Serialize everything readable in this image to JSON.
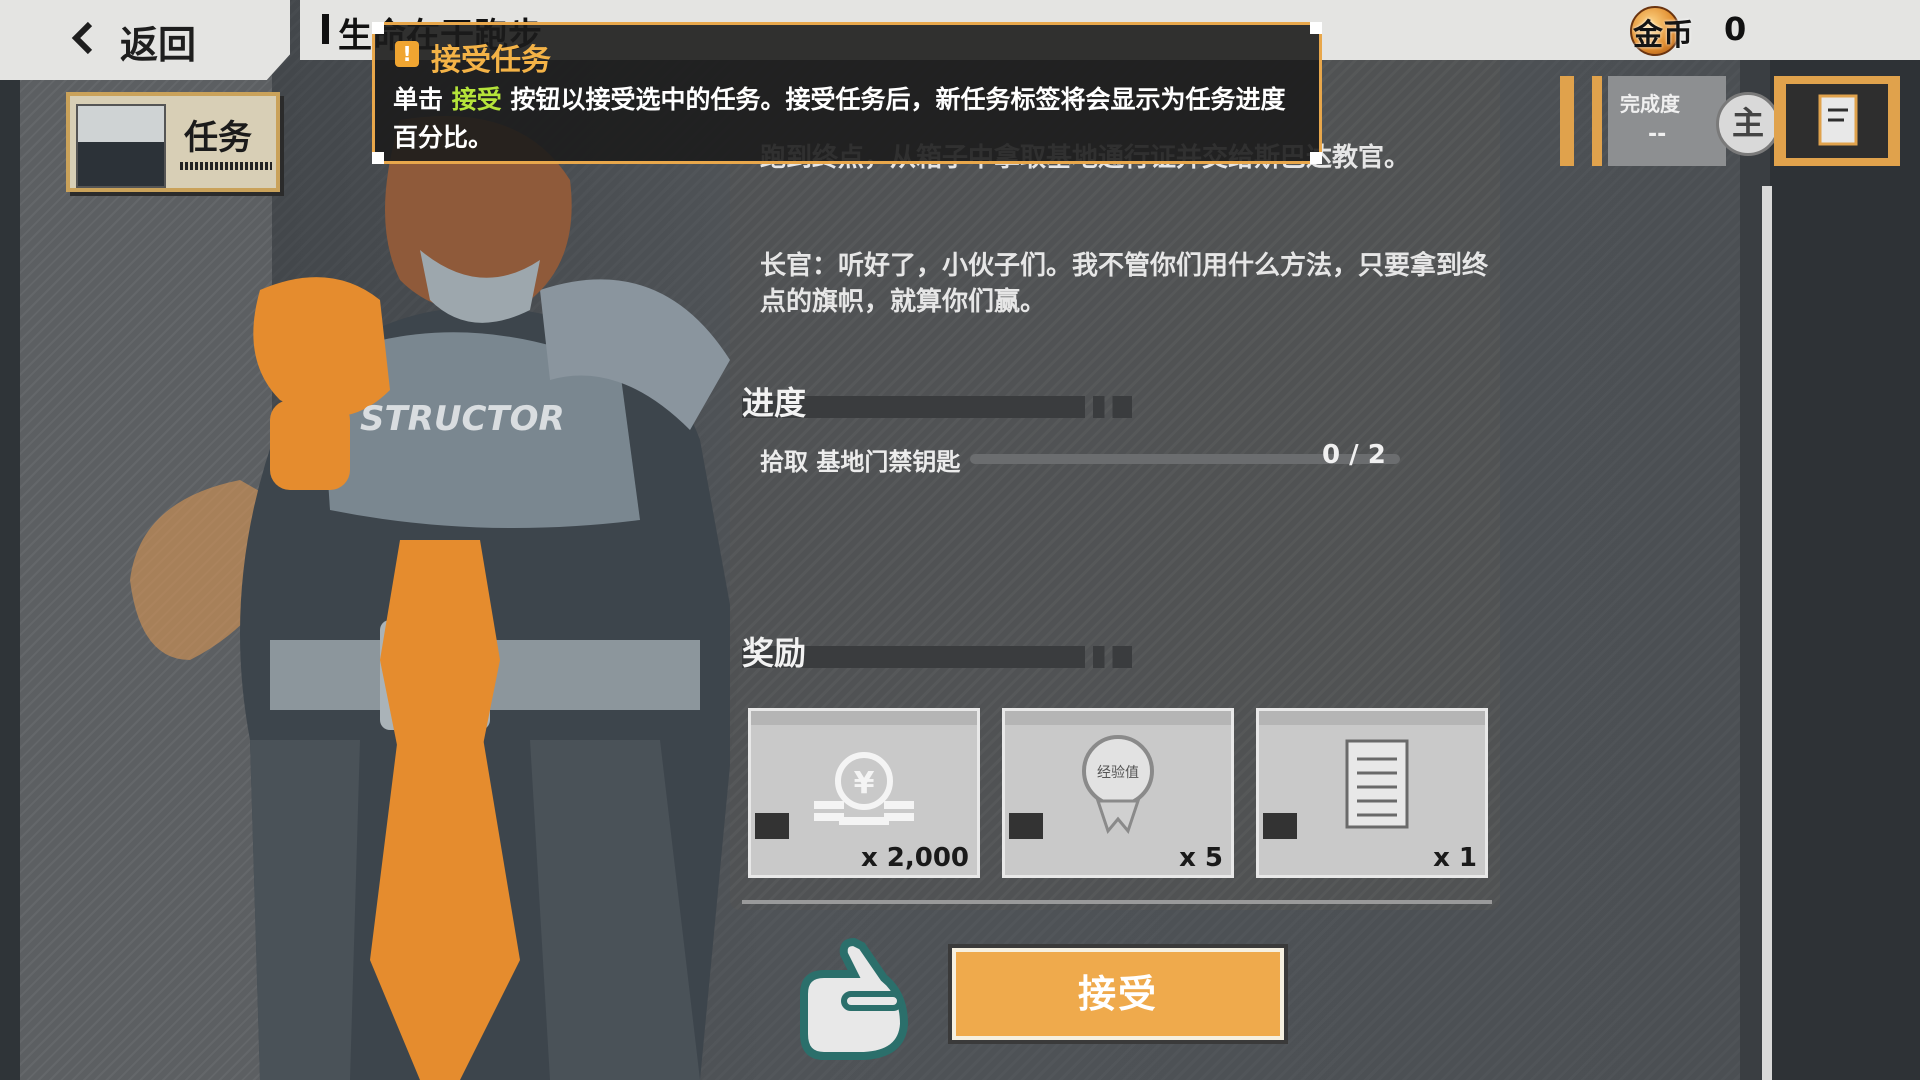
{
  "header": {
    "back_label": "返回",
    "quest_title": "生命在于跑步",
    "currency_label": "金币",
    "currency_value": "0"
  },
  "left_tab": {
    "label": "任务"
  },
  "quest": {
    "description_1": "跑到终点，从箱子中拿取基地通行证并交给斯巴达教官。",
    "description_2": "长官：听好了，小伙子们。我不管你们用什么方法，只要拿到终点的旗帜，就算你们赢。",
    "progress_heading": "进度",
    "objective_label": "拾取 基地门禁钥匙",
    "objective_count": "0 / 2",
    "rewards_heading": "奖励",
    "rewards": [
      {
        "icon": "coin-stack-icon",
        "quantity": "x 2,000"
      },
      {
        "icon": "experience-medal-icon",
        "quantity": "x 5"
      },
      {
        "icon": "document-icon",
        "quantity": "x 1"
      }
    ],
    "exp_medal_text": "经验值",
    "accept_label": "接受"
  },
  "progress_widget": {
    "label": "完成度",
    "value": "--",
    "main_label": "主"
  },
  "tooltip": {
    "title": "接受任务",
    "body_prefix": "单击",
    "body_highlight": "接受",
    "body_suffix": "按钮以接受选中的任务。接受任务后，新任务标签将会显示为任务进度百分比。"
  },
  "colors": {
    "accent_orange": "#efaa4c",
    "tooltip_border": "#e8a74b",
    "highlight_green": "#b5e43a"
  }
}
